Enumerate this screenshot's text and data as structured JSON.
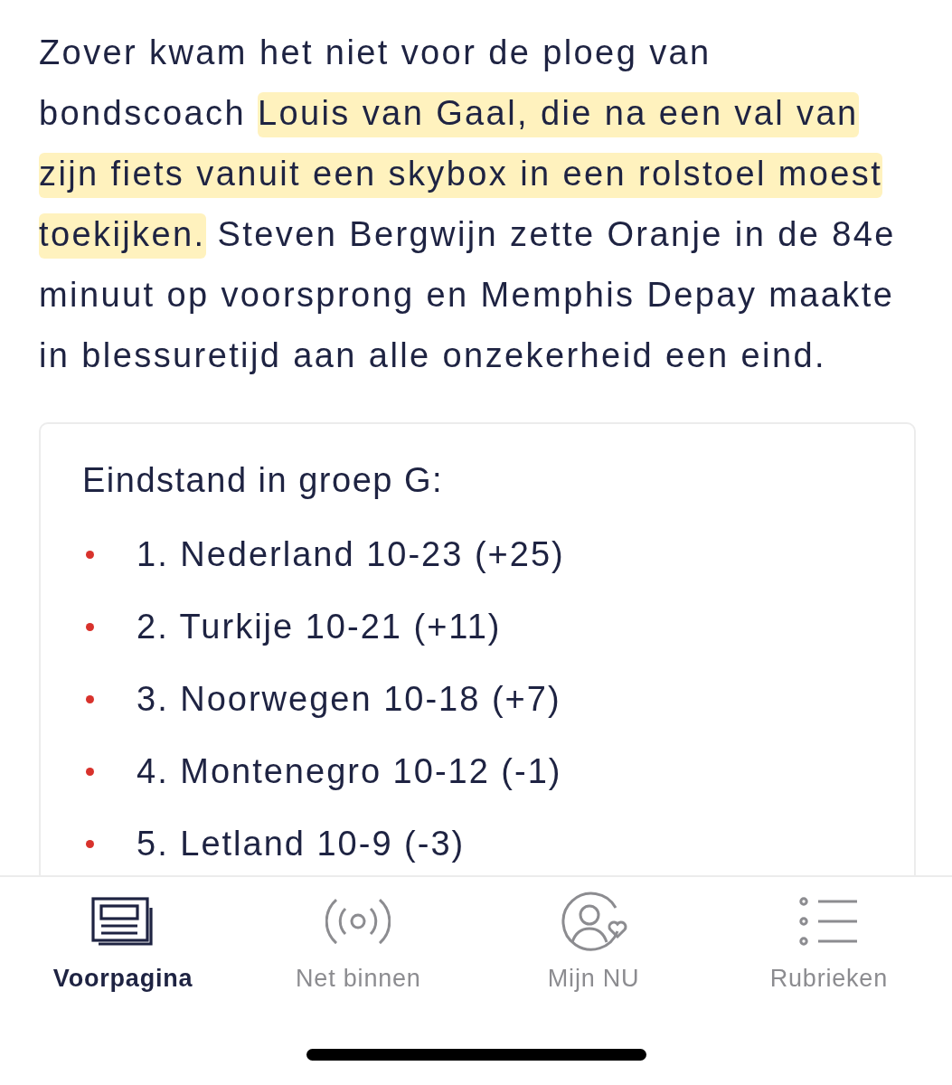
{
  "article": {
    "paragraph": [
      {
        "text": "Zover kwam het niet voor de ploeg van bondscoach ",
        "highlighted": false
      },
      {
        "text": "Louis van Gaal, die na een val van zijn fiets vanuit een skybox in een rolstoel moest toekijken.",
        "highlighted": true
      },
      {
        "text": " Steven Bergwijn zette Oranje in de 84e minuut op voorsprong en Memphis Depay maakte in blessuretijd aan alle onzekerheid een eind.",
        "highlighted": false
      }
    ]
  },
  "standings": {
    "title": "Eindstand in groep G:",
    "items": [
      "1. Nederland 10-23 (+25)",
      "2. Turkije 10-21 (+11)",
      "3. Noorwegen 10-18 (+7)",
      "4. Montenegro 10-12 (-1)",
      "5. Letland 10-9 (-3)"
    ]
  },
  "tab_bar": {
    "tabs": [
      {
        "label": "Voorpagina",
        "selected": true
      },
      {
        "label": "Net binnen",
        "selected": false
      },
      {
        "label": "Mijn NU",
        "selected": false
      },
      {
        "label": "Rubrieken",
        "selected": false
      }
    ]
  }
}
